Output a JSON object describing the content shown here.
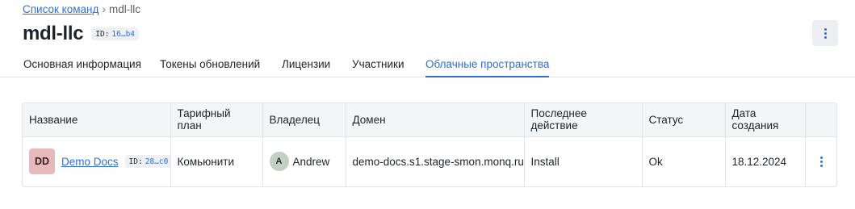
{
  "breadcrumb": {
    "parent": "Список команд",
    "separator": "›",
    "current": "mdl-llc"
  },
  "header": {
    "title": "mdl-llc",
    "id_label": "ID:",
    "id_value": "16…b4",
    "menu_icon": "kebab-vertical-icon"
  },
  "tabs": [
    {
      "label": "Основная информация",
      "active": false
    },
    {
      "label": "Токены обновлений",
      "active": false
    },
    {
      "label": "Лицензии",
      "active": false
    },
    {
      "label": "Участники",
      "active": false
    },
    {
      "label": "Облачные пространства",
      "active": true
    }
  ],
  "table": {
    "columns": [
      "Название",
      "Тарифный план",
      "Владелец",
      "Домен",
      "Последнее действие",
      "Статус",
      "Дата создания",
      ""
    ],
    "rows": [
      {
        "avatar": "DD",
        "name": "Demo Docs",
        "id_label": "ID:",
        "id_value": "28…c0",
        "plan": "Комьюнити",
        "owner_initial": "A",
        "owner": "Andrew",
        "domain": "demo-docs.s1.stage-smon.monq.ru",
        "last_action": "Install",
        "status": "Ok",
        "created": "18.12.2024",
        "menu_icon": "kebab-vertical-icon"
      }
    ]
  },
  "colors": {
    "accent": "#2f6fd6",
    "avatar_dd_bg": "#e6b9bc",
    "owner_avatar_bg": "#c3cfc3",
    "header_bg": "#f4f5f7"
  }
}
